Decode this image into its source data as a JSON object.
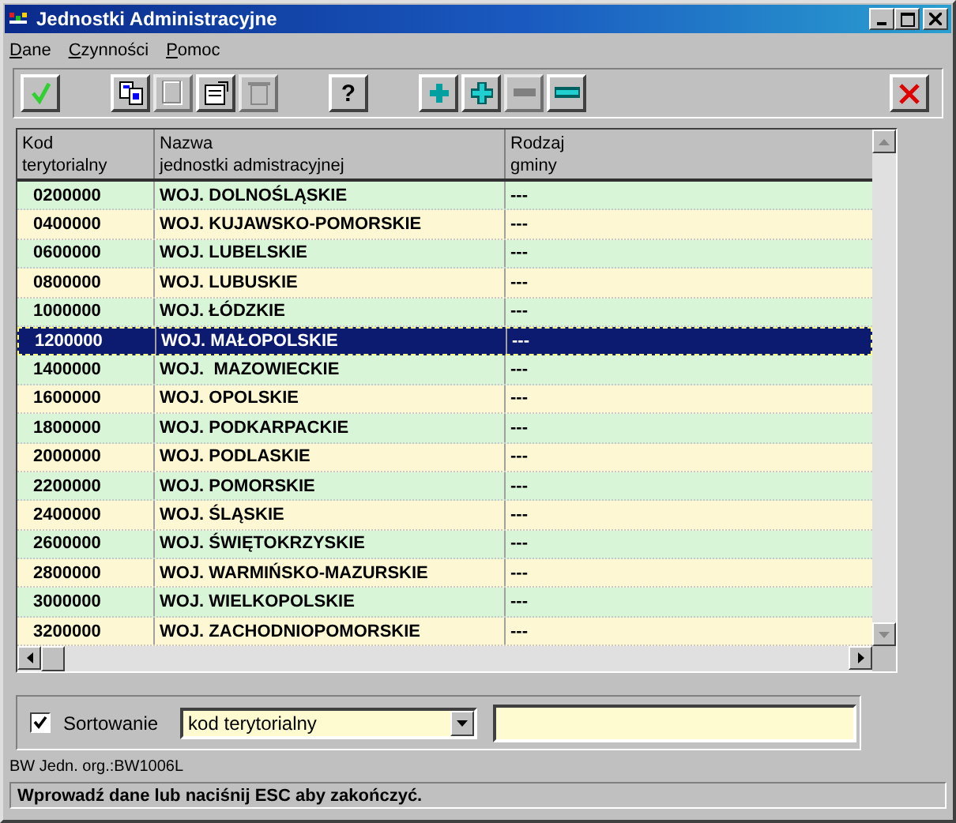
{
  "window": {
    "title": "Jednostki Administracyjne"
  },
  "menu": [
    {
      "label": "Dane"
    },
    {
      "label": "Czynności"
    },
    {
      "label": "Pomoc"
    }
  ],
  "toolbar": [
    {
      "kind": "ok",
      "disabled": false
    },
    {
      "kind": "gap"
    },
    {
      "kind": "copy",
      "disabled": false
    },
    {
      "kind": "page",
      "disabled": true
    },
    {
      "kind": "edit",
      "disabled": false
    },
    {
      "kind": "trash",
      "disabled": true
    },
    {
      "kind": "gap"
    },
    {
      "kind": "help",
      "label": "?",
      "disabled": false
    },
    {
      "kind": "gap"
    },
    {
      "kind": "plus",
      "disabled": false
    },
    {
      "kind": "plus2",
      "disabled": false
    },
    {
      "kind": "minus",
      "disabled": true
    },
    {
      "kind": "minus2",
      "disabled": false
    },
    {
      "kind": "spacer"
    },
    {
      "kind": "cancel",
      "disabled": false
    }
  ],
  "table": {
    "columns": [
      "Kod\nterytorialny",
      "Nazwa\njednostki admistracyjnej",
      "Rodzaj\ngminy"
    ],
    "rows": [
      {
        "cells": [
          "0200000",
          "WOJ. DOLNOŚLĄSKIE",
          "---"
        ],
        "selected": false
      },
      {
        "cells": [
          "0400000",
          "WOJ. KUJAWSKO-POMORSKIE",
          "---"
        ],
        "selected": false
      },
      {
        "cells": [
          "0600000",
          "WOJ. LUBELSKIE",
          "---"
        ],
        "selected": false
      },
      {
        "cells": [
          "0800000",
          "WOJ. LUBUSKIE",
          "---"
        ],
        "selected": false
      },
      {
        "cells": [
          "1000000",
          "WOJ. ŁÓDZKIE",
          "---"
        ],
        "selected": false
      },
      {
        "cells": [
          "1200000",
          "WOJ. MAŁOPOLSKIE",
          "---"
        ],
        "selected": true
      },
      {
        "cells": [
          "1400000",
          "WOJ.  MAZOWIECKIE",
          "---"
        ],
        "selected": false
      },
      {
        "cells": [
          "1600000",
          "WOJ. OPOLSKIE",
          "---"
        ],
        "selected": false
      },
      {
        "cells": [
          "1800000",
          "WOJ. PODKARPACKIE",
          "---"
        ],
        "selected": false
      },
      {
        "cells": [
          "2000000",
          "WOJ. PODLASKIE",
          "---"
        ],
        "selected": false
      },
      {
        "cells": [
          "2200000",
          "WOJ. POMORSKIE",
          "---"
        ],
        "selected": false
      },
      {
        "cells": [
          "2400000",
          "WOJ. ŚLĄSKIE",
          "---"
        ],
        "selected": false
      },
      {
        "cells": [
          "2600000",
          "WOJ. ŚWIĘTOKRZYSKIE",
          "---"
        ],
        "selected": false
      },
      {
        "cells": [
          "2800000",
          "WOJ. WARMIŃSKO-MAZURSKIE",
          "---"
        ],
        "selected": false
      },
      {
        "cells": [
          "3000000",
          "WOJ. WIELKOPOLSKIE",
          "---"
        ],
        "selected": false
      },
      {
        "cells": [
          "3200000",
          "WOJ. ZACHODNIOPOMORSKIE",
          "---"
        ],
        "selected": false
      }
    ]
  },
  "sort": {
    "label": "Sortowanie",
    "checked": true,
    "value": "kod terytorialny"
  },
  "info": "BW Jedn. org.:BW1006L",
  "status_bar": "Wprowadź dane lub naciśnij ESC aby zakończyć."
}
